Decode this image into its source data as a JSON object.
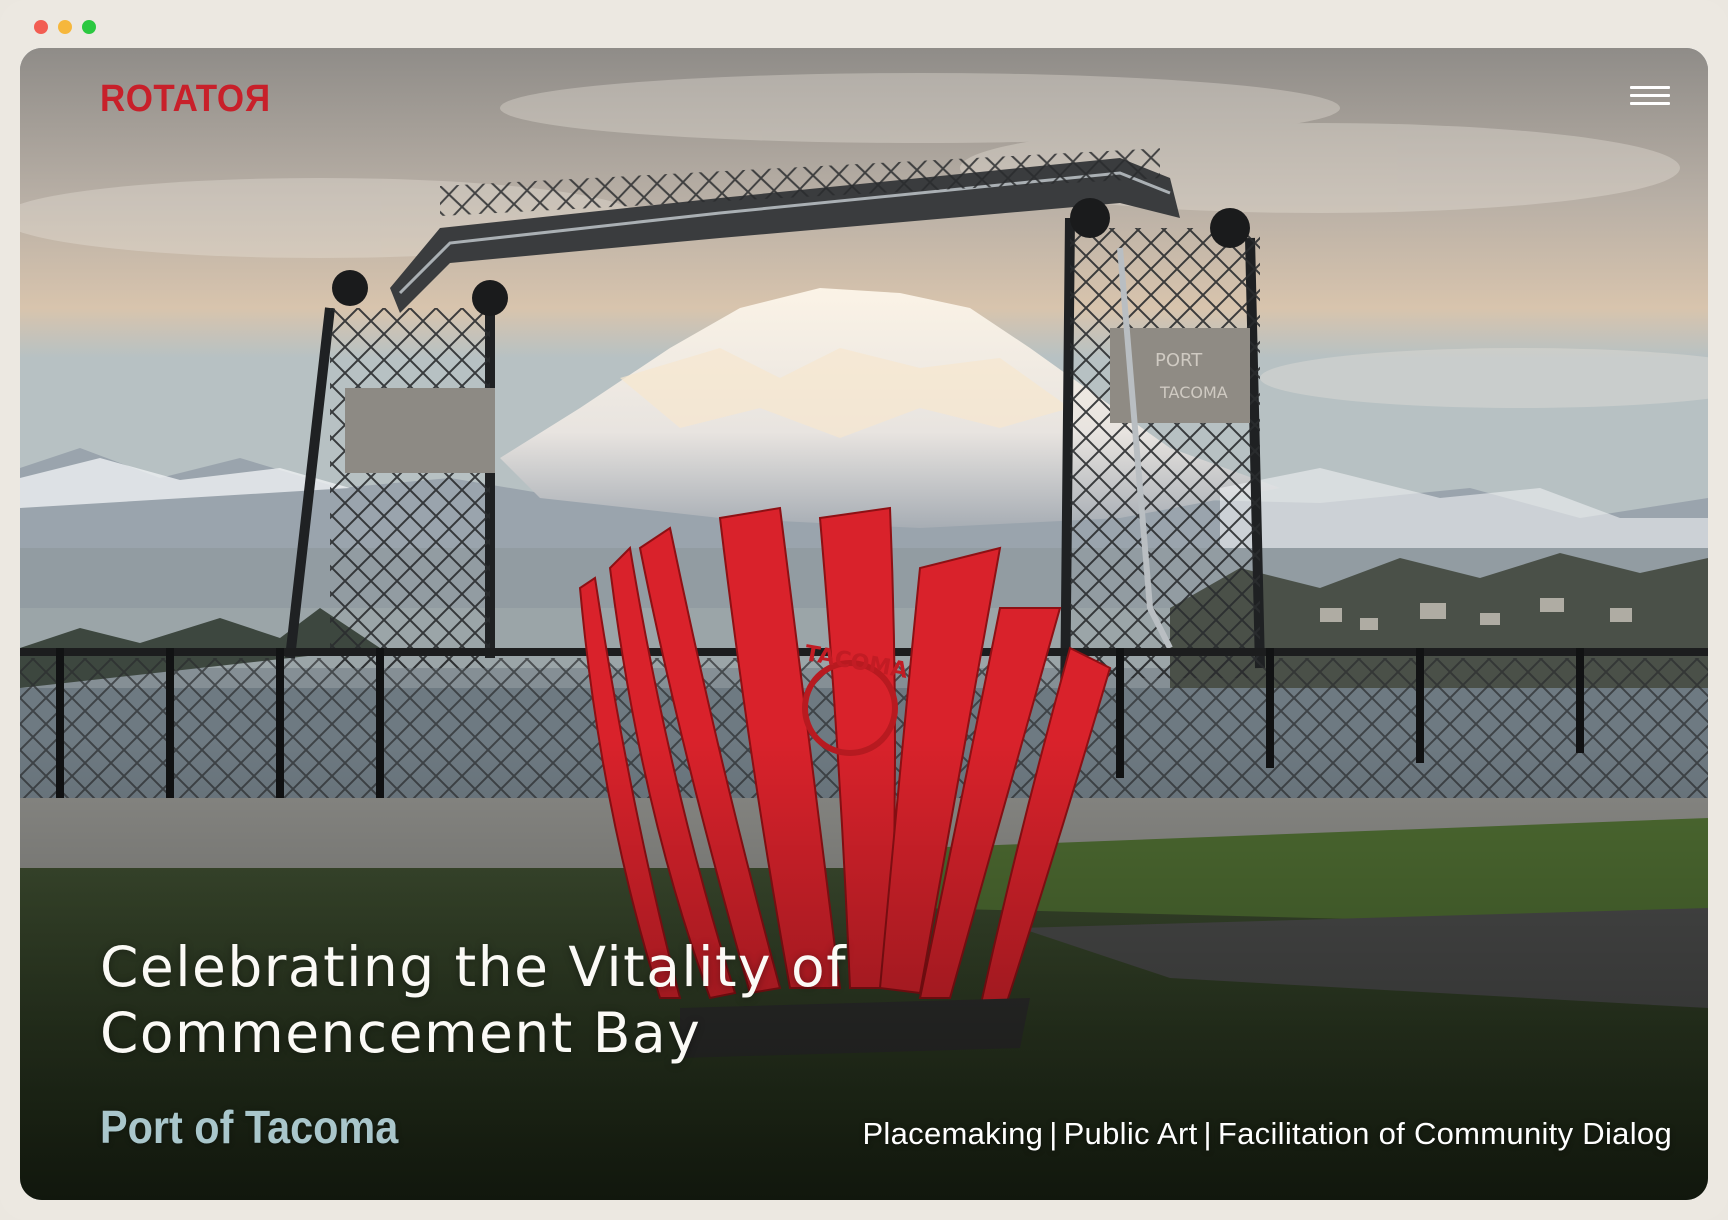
{
  "window": {
    "controls": [
      "close",
      "minimize",
      "zoom"
    ]
  },
  "header": {
    "logo_text": "ROTATOR",
    "logo_main": "ROTATO",
    "logo_reversed": "R",
    "menu_icon": "hamburger-icon"
  },
  "hero": {
    "title": "Celebrating the Vitality of Commencement Bay",
    "client": "Port of Tacoma",
    "services": [
      "Placemaking",
      "Public Art",
      "Facilitation of Community Dialog"
    ],
    "separator": "|",
    "image": {
      "bridge_sign": "PORT OF TACOMA",
      "sculpture_sign": "TACOMA",
      "sculpture_color": "#d9222b"
    }
  },
  "colors": {
    "brand_red": "#c8202a",
    "title_white": "#fbfaf6",
    "client_teal": "#a9c6cb"
  }
}
